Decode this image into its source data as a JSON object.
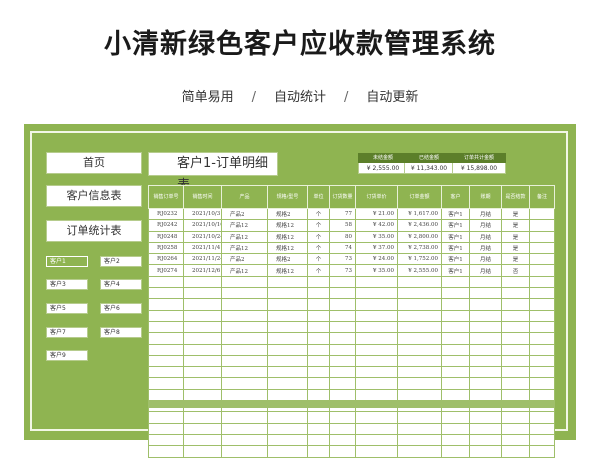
{
  "page": {
    "headline": "小清新绿色客户应收款管理系统",
    "features": [
      "简单易用",
      "自动统计",
      "自动更新"
    ],
    "separator": "/"
  },
  "nav": {
    "home": "首页",
    "customer_info": "客户信息表",
    "order_stats": "订单统计表",
    "customers": [
      "客户1",
      "客户2",
      "客户3",
      "客户4",
      "客户5",
      "客户6",
      "客户7",
      "客户8",
      "客户9"
    ],
    "active_customer": "客户1"
  },
  "sheet": {
    "title": "客户1-订单明细表",
    "summary": [
      {
        "label": "未结金额",
        "value": "¥ 2,555.00"
      },
      {
        "label": "已结金额",
        "value": "¥ 11,343.00"
      },
      {
        "label": "订单共计金额",
        "value": "¥ 15,898.00"
      }
    ]
  },
  "table": {
    "columns": [
      "销售订单号",
      "销售时间",
      "产品",
      "规格/型号",
      "单位",
      "订货数量",
      "订货单价",
      "订单金额",
      "客户",
      "账期",
      "是否结款",
      "备注"
    ],
    "rows": [
      [
        "RJ0232",
        "2021/10/3",
        "产品2",
        "规格2",
        "个",
        "77",
        "¥ 21.00",
        "¥ 1,617.00",
        "客户1",
        "月结",
        "是",
        ""
      ],
      [
        "RJ0242",
        "2021/10/16",
        "产品12",
        "规格12",
        "个",
        "58",
        "¥ 42.00",
        "¥ 2,436.00",
        "客户1",
        "月结",
        "是",
        ""
      ],
      [
        "RJ0248",
        "2021/10/24",
        "产品12",
        "规格12",
        "个",
        "80",
        "¥ 35.00",
        "¥ 2,800.00",
        "客户1",
        "月结",
        "是",
        ""
      ],
      [
        "RJ0258",
        "2021/11/4",
        "产品12",
        "规格12",
        "个",
        "74",
        "¥ 37.00",
        "¥ 2,738.00",
        "客户1",
        "月结",
        "是",
        ""
      ],
      [
        "RJ0264",
        "2021/11/24",
        "产品2",
        "规格2",
        "个",
        "73",
        "¥ 24.00",
        "¥ 1,752.00",
        "客户1",
        "月结",
        "是",
        ""
      ],
      [
        "RJ0274",
        "2021/12/6",
        "产品12",
        "规格12",
        "个",
        "73",
        "¥ 35.00",
        "¥ 2,555.00",
        "客户1",
        "月结",
        "否",
        ""
      ]
    ],
    "empty_row_count": 16
  },
  "colors": {
    "panel_green": "#8fb451",
    "header_dark_green": "#5c7f2a",
    "grid_line": "#9fbf6a"
  }
}
